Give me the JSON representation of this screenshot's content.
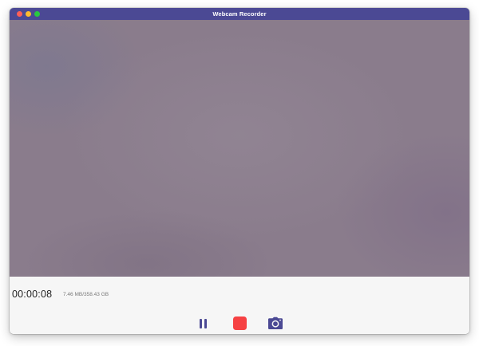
{
  "window": {
    "title": "Webcam Recorder"
  },
  "recording": {
    "elapsed": "00:00:08",
    "storage": "7.46 MB/358.43 GB"
  },
  "controls": {
    "pause_icon": "pause-icon",
    "stop_icon": "stop-icon",
    "snapshot_icon": "camera-icon"
  },
  "colors": {
    "titlebar": "#4b4994",
    "accent": "#4b4994",
    "stop": "#f64143",
    "close": "#fe5f57",
    "minimize": "#febb2e",
    "maximize": "#29c840"
  }
}
